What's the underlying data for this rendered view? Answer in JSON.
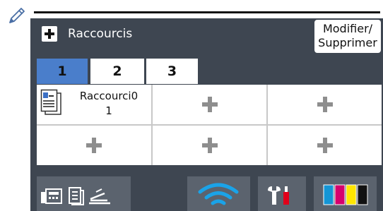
{
  "header": {
    "title": "Raccourcis",
    "modify_label_line1": "Modifier/",
    "modify_label_line2": "Supprimer"
  },
  "tabs": [
    {
      "label": "1",
      "active": true
    },
    {
      "label": "2",
      "active": false
    },
    {
      "label": "3",
      "active": false
    }
  ],
  "shortcuts": [
    {
      "label": "Raccourci0\n1",
      "icon": "copy-document-icon"
    },
    {
      "label": "",
      "icon": "add-plus-icon"
    },
    {
      "label": "",
      "icon": "add-plus-icon"
    },
    {
      "label": "",
      "icon": "add-plus-icon"
    },
    {
      "label": "",
      "icon": "add-plus-icon"
    },
    {
      "label": "",
      "icon": "add-plus-icon"
    }
  ],
  "bottom_bar": {
    "buttons": [
      "fax-copy-scan-icon",
      "wifi-icon",
      "settings-tools-icon",
      "ink-cartridge-icon"
    ]
  },
  "colors": {
    "screen_bg": "#3e4651",
    "tab_active": "#4a7ecb",
    "plus_gray": "#8e8e8e",
    "wifi_blue": "#1aa3e8",
    "ink_cyan": "#1495d5",
    "ink_magenta": "#d6006d",
    "ink_yellow": "#ffe600",
    "ink_black": "#111111"
  }
}
